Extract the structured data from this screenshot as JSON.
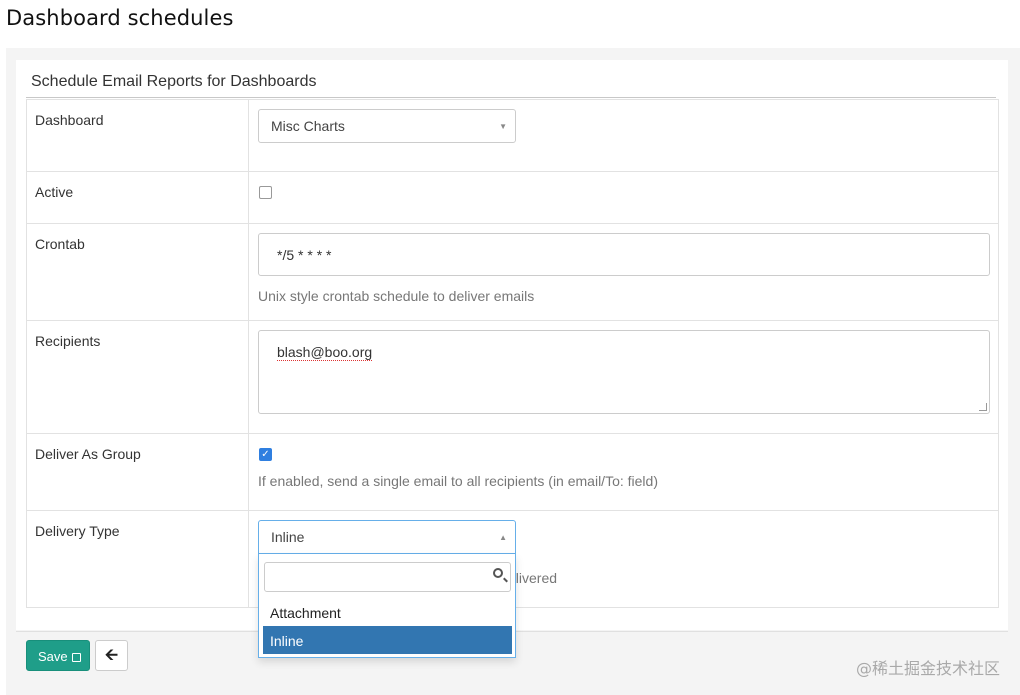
{
  "page_title": "Dashboard schedules",
  "panel_title": "Schedule Email Reports for Dashboards",
  "fields": {
    "dashboard": {
      "label": "Dashboard",
      "value": "Misc Charts"
    },
    "active": {
      "label": "Active",
      "checked": false
    },
    "crontab": {
      "label": "Crontab",
      "value": "*/5 * * * *",
      "help": "Unix style crontab schedule to deliver emails"
    },
    "recipients": {
      "label": "Recipients",
      "value": "blash@boo.org"
    },
    "deliver_as_group": {
      "label": "Deliver As Group",
      "checked": true,
      "help": "If enabled, send a single email to all recipients (in email/To: field)"
    },
    "delivery_type": {
      "label": "Delivery Type",
      "value": "Inline",
      "help_tail": "elivered"
    }
  },
  "dropdown": {
    "search_placeholder": "",
    "options": [
      "Attachment",
      "Inline"
    ],
    "selected": "Inline"
  },
  "buttons": {
    "save": "Save",
    "back_icon": "arrow-left-icon"
  },
  "watermark": "@稀土掘金技术社区",
  "colors": {
    "save": "#1f9e89",
    "selected_option": "#3276b1",
    "checkbox_checked": "#2f7fe0"
  }
}
